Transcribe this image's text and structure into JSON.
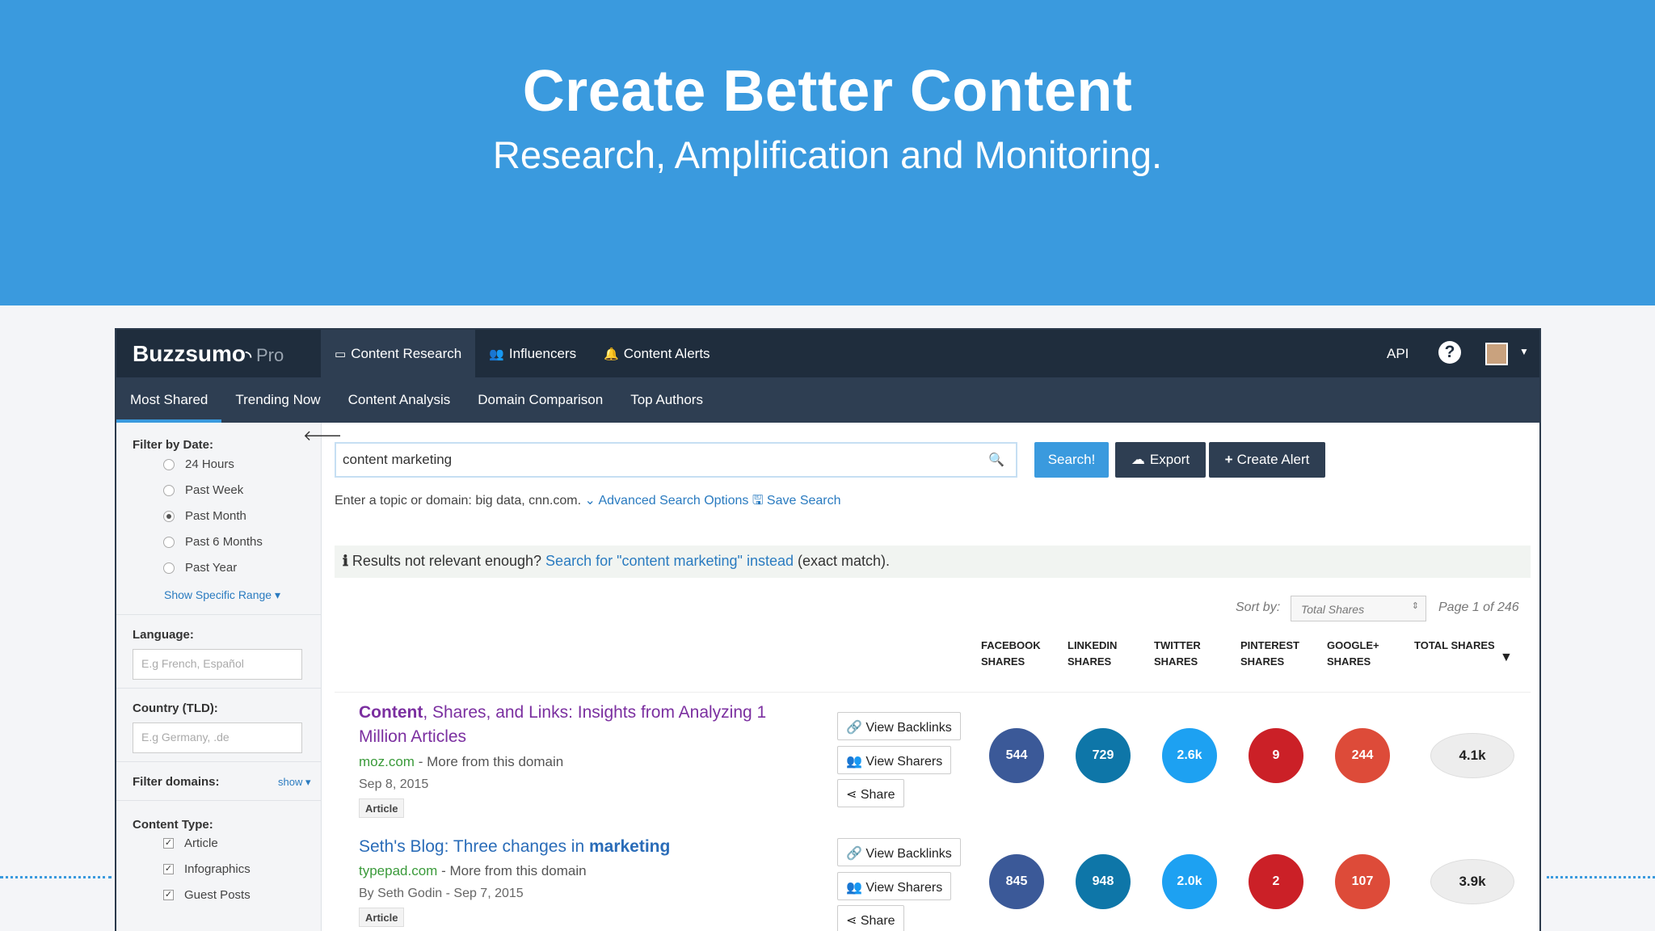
{
  "hero": {
    "title": "Create Better Content",
    "subtitle": "Research, Amplification and Monitoring."
  },
  "topbar": {
    "logo": "Buzzsumo",
    "logo_suffix": "Pro",
    "nav": [
      "Content Research",
      "Influencers",
      "Content Alerts"
    ],
    "api": "API",
    "help": "?"
  },
  "subnav": [
    "Most Shared",
    "Trending Now",
    "Content Analysis",
    "Domain Comparison",
    "Top Authors"
  ],
  "sidebar": {
    "filter_date_label": "Filter by Date:",
    "date_options": [
      "24 Hours",
      "Past Week",
      "Past Month",
      "Past 6 Months",
      "Past Year"
    ],
    "date_selected": "Past Month",
    "show_range": "Show Specific Range ▾",
    "language_label": "Language:",
    "language_placeholder": "E.g French, Español",
    "country_label": "Country (TLD):",
    "country_placeholder": "E.g Germany, .de",
    "filter_domains_label": "Filter domains:",
    "filter_domains_show": "show ▾",
    "content_type_label": "Content Type:",
    "content_types": [
      "Article",
      "Infographics",
      "Guest Posts"
    ]
  },
  "search": {
    "value": "content marketing",
    "search_button": "Search!",
    "export_button": "Export",
    "alert_button": "Create Alert",
    "hint": "Enter a topic or domain: big data, cnn.com.",
    "advanced": "Advanced Search Options",
    "save": "Save Search"
  },
  "notice": {
    "prefix": "Results not relevant enough?",
    "link": "Search for \"content marketing\" instead",
    "suffix": "(exact match)."
  },
  "sort": {
    "label": "Sort by:",
    "selected": "Total Shares",
    "page": "Page 1 of 246"
  },
  "columns": [
    [
      "FACEBOOK",
      "SHARES"
    ],
    [
      "LINKEDIN",
      "SHARES"
    ],
    [
      "TWITTER",
      "SHARES"
    ],
    [
      "PINTEREST",
      "SHARES"
    ],
    [
      "GOOGLE+",
      "SHARES"
    ],
    [
      "TOTAL SHARES",
      ""
    ]
  ],
  "actions": [
    "View Backlinks",
    "View Sharers",
    "Share"
  ],
  "results": [
    {
      "title_bold": "Content",
      "title_rest": ", Shares, and Links: Insights from Analyzing 1 Million Articles",
      "domain": "moz.com",
      "more": "- More from this domain",
      "date": "Sep 8, 2015",
      "tag": "Article",
      "facebook": "544",
      "linkedin": "729",
      "twitter": "2.6k",
      "pinterest": "9",
      "google": "244",
      "total": "4.1k"
    },
    {
      "title_plain": "Seth's Blog: Three changes in ",
      "title_bold": "marketing",
      "domain": "typepad.com",
      "more": "- More from this domain",
      "date": "By Seth Godin - Sep 7, 2015",
      "tag": "Article",
      "facebook": "845",
      "linkedin": "948",
      "twitter": "2.0k",
      "pinterest": "2",
      "google": "107",
      "total": "3.9k"
    }
  ],
  "colors": {
    "hero_bg": "#3a9ade",
    "nav_bg": "#1f2d3d",
    "facebook": "#3b5998",
    "linkedin": "#0e76a8",
    "twitter": "#1da1f2",
    "pinterest": "#cb2027",
    "google": "#dd4b39"
  }
}
